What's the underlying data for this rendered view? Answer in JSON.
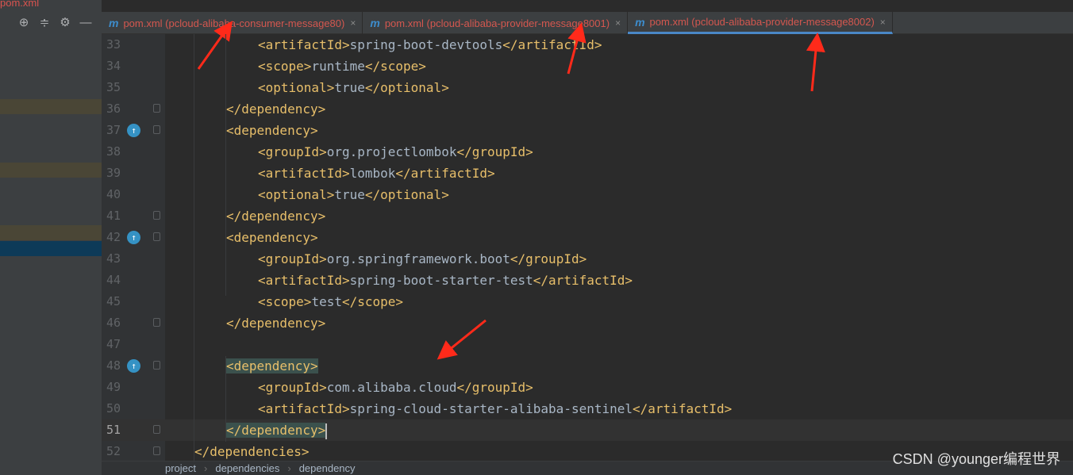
{
  "left_panel": {
    "file_label": "pom.xml",
    "toolbar_icons": [
      "crosshair-icon",
      "collapse-icon",
      "gear-icon",
      "minimize-icon"
    ]
  },
  "tabs": [
    {
      "label": "pom.xml (pcloud-alibaba-consumer-message80)",
      "active": false
    },
    {
      "label": "pom.xml (pcloud-alibaba-provider-message8001)",
      "active": false
    },
    {
      "label": "pom.xml (pcloud-alibaba-provider-message8002)",
      "active": true
    }
  ],
  "tab_icon": "m",
  "tab_close": "×",
  "code_lines": [
    {
      "n": "33",
      "indent": 3,
      "open": "<artifactId>",
      "text": "spring-boot-devtools",
      "close": "</artifactId>"
    },
    {
      "n": "34",
      "indent": 3,
      "open": "<scope>",
      "text": "runtime",
      "close": "</scope>"
    },
    {
      "n": "35",
      "indent": 3,
      "open": "<optional>",
      "text": "true",
      "close": "</optional>"
    },
    {
      "n": "36",
      "indent": 2,
      "open": "</dependency>",
      "text": "",
      "close": ""
    },
    {
      "n": "37",
      "indent": 2,
      "open": "<dependency>",
      "text": "",
      "close": ""
    },
    {
      "n": "38",
      "indent": 3,
      "open": "<groupId>",
      "text": "org.projectlombok",
      "close": "</groupId>"
    },
    {
      "n": "39",
      "indent": 3,
      "open": "<artifactId>",
      "text": "lombok",
      "close": "</artifactId>"
    },
    {
      "n": "40",
      "indent": 3,
      "open": "<optional>",
      "text": "true",
      "close": "</optional>"
    },
    {
      "n": "41",
      "indent": 2,
      "open": "</dependency>",
      "text": "",
      "close": ""
    },
    {
      "n": "42",
      "indent": 2,
      "open": "<dependency>",
      "text": "",
      "close": ""
    },
    {
      "n": "43",
      "indent": 3,
      "open": "<groupId>",
      "text": "org.springframework.boot",
      "close": "</groupId>"
    },
    {
      "n": "44",
      "indent": 3,
      "open": "<artifactId>",
      "text": "spring-boot-starter-test",
      "close": "</artifactId>"
    },
    {
      "n": "45",
      "indent": 3,
      "open": "<scope>",
      "text": "test",
      "close": "</scope>"
    },
    {
      "n": "46",
      "indent": 2,
      "open": "</dependency>",
      "text": "",
      "close": ""
    },
    {
      "n": "47",
      "indent": 0,
      "open": "",
      "text": "",
      "close": ""
    },
    {
      "n": "48",
      "indent": 2,
      "open": "<dependency>",
      "text": "",
      "close": "",
      "highlight": true
    },
    {
      "n": "49",
      "indent": 3,
      "open": "<groupId>",
      "text": "com.alibaba.cloud",
      "close": "</groupId>"
    },
    {
      "n": "50",
      "indent": 3,
      "open": "<artifactId>",
      "text": "spring-cloud-starter-alibaba-sentinel",
      "close": "</artifactId>"
    },
    {
      "n": "51",
      "indent": 2,
      "open": "</dependency>",
      "text": "",
      "close": "",
      "highlight": true,
      "current": true
    },
    {
      "n": "52",
      "indent": 1,
      "open": "</dependencies>",
      "text": "",
      "close": ""
    }
  ],
  "gutter_run_lines": [
    "37",
    "42",
    "48"
  ],
  "fold_lines": [
    "36",
    "37",
    "41",
    "42",
    "46",
    "48",
    "51",
    "52"
  ],
  "breadcrumb": [
    "project",
    "dependencies",
    "dependency"
  ],
  "breadcrumb_sep": "›",
  "watermark": "CSDN @younger编程世界",
  "colors": {
    "tag": "#e8bf6a",
    "text": "#a9b7c6",
    "tab_label": "#d4574f",
    "accent": "#4a88c7",
    "annotation_arrow": "#ff2a1a"
  }
}
